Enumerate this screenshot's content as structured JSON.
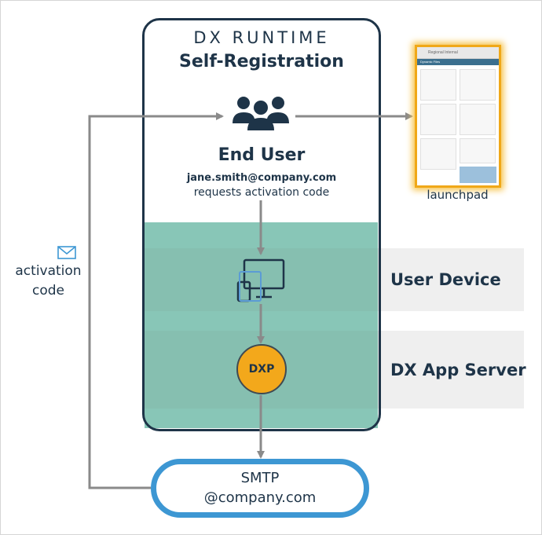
{
  "runtime": {
    "title": "DX RUNTIME",
    "subtitle": "Self-Registration"
  },
  "end_user": {
    "label": "End User",
    "email": "jane.smith@company.com",
    "action": "requests activation code",
    "icon": "users-icon"
  },
  "launchpad": {
    "label": "launchpad",
    "header": "Regional Internal",
    "subheader": "Dynamic Files"
  },
  "layers": {
    "user_device": "User Device",
    "app_server": "DX App Server"
  },
  "dxp": {
    "label": "DXP"
  },
  "smtp": {
    "line1": "SMTP",
    "line2": "@company.com"
  },
  "activation": {
    "line1": "activation",
    "line2": "code",
    "icon": "envelope-icon"
  },
  "colors": {
    "navy": "#1e3448",
    "teal": "#88c6b7",
    "orange": "#f3a81b",
    "blue": "#3d97d3",
    "arrow": "#8a8a8a",
    "band": "#efefef"
  }
}
